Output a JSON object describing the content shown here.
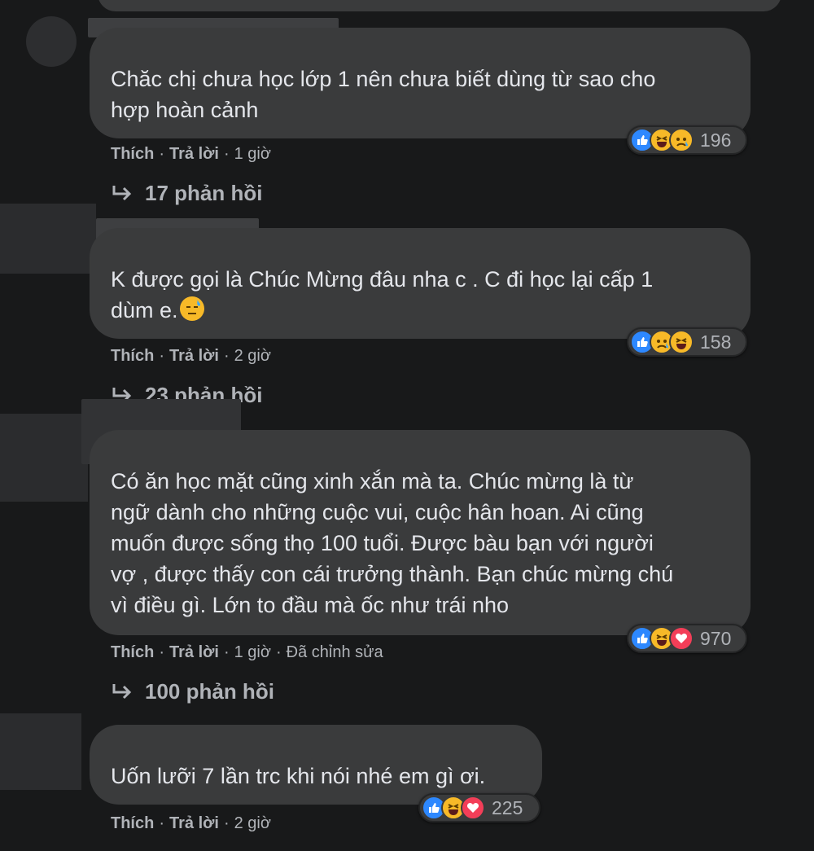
{
  "colors": {
    "background": "#18191a",
    "bubble": "#3a3b3c",
    "text": "#e4e6eb",
    "secondary": "#b0b3b8",
    "like": "#2d88ff",
    "love": "#f33e58",
    "haha": "#f7b928"
  },
  "comments": [
    {
      "text": "Chăc chị chưa học lớp 1 nên chưa biết dùng từ sao cho\nhợp hoàn cảnh",
      "reactions": [
        "like-icon",
        "haha-icon",
        "sad-icon"
      ],
      "reaction_count": "196",
      "like_label": "Thích",
      "reply_label": "Trả lời",
      "time": "1 giờ",
      "edited": "",
      "replies_label": "17 phản hồi"
    },
    {
      "text": "K được gọi là Chúc Mừng đâu nha c . C đi học lại cấp 1\ndùm e.",
      "reactions": [
        "like-icon",
        "sad-icon",
        "haha-icon"
      ],
      "reaction_count": "158",
      "like_label": "Thích",
      "reply_label": "Trả lời",
      "time": "2 giờ",
      "edited": "",
      "replies_label": "23 phản hồi"
    },
    {
      "text": "Có ăn học mặt cũng xinh xắn mà ta. Chúc mừng là từ\nngữ dành cho những cuộc vui, cuộc hân hoan. Ai cũng\nmuốn được sống thọ 100 tuổi. Được bàu bạn với người\nvợ , được thấy con cái trưởng thành. Bạn chúc mừng chú\nvì điều gì. Lớn to đầu mà ốc như trái nho",
      "reactions": [
        "like-icon",
        "haha-icon",
        "love-icon"
      ],
      "reaction_count": "970",
      "like_label": "Thích",
      "reply_label": "Trả lời",
      "time": "1 giờ",
      "edited": "Đã chỉnh sửa",
      "replies_label": "100 phản hồi"
    },
    {
      "text": "Uốn lưỡi 7 lần trc khi nói nhé em gì ơi.",
      "reactions": [
        "like-icon",
        "haha-icon",
        "love-icon"
      ],
      "reaction_count": "225",
      "like_label": "Thích",
      "reply_label": "Trả lời",
      "time": "2 giờ",
      "edited": "",
      "replies_label": ""
    }
  ]
}
